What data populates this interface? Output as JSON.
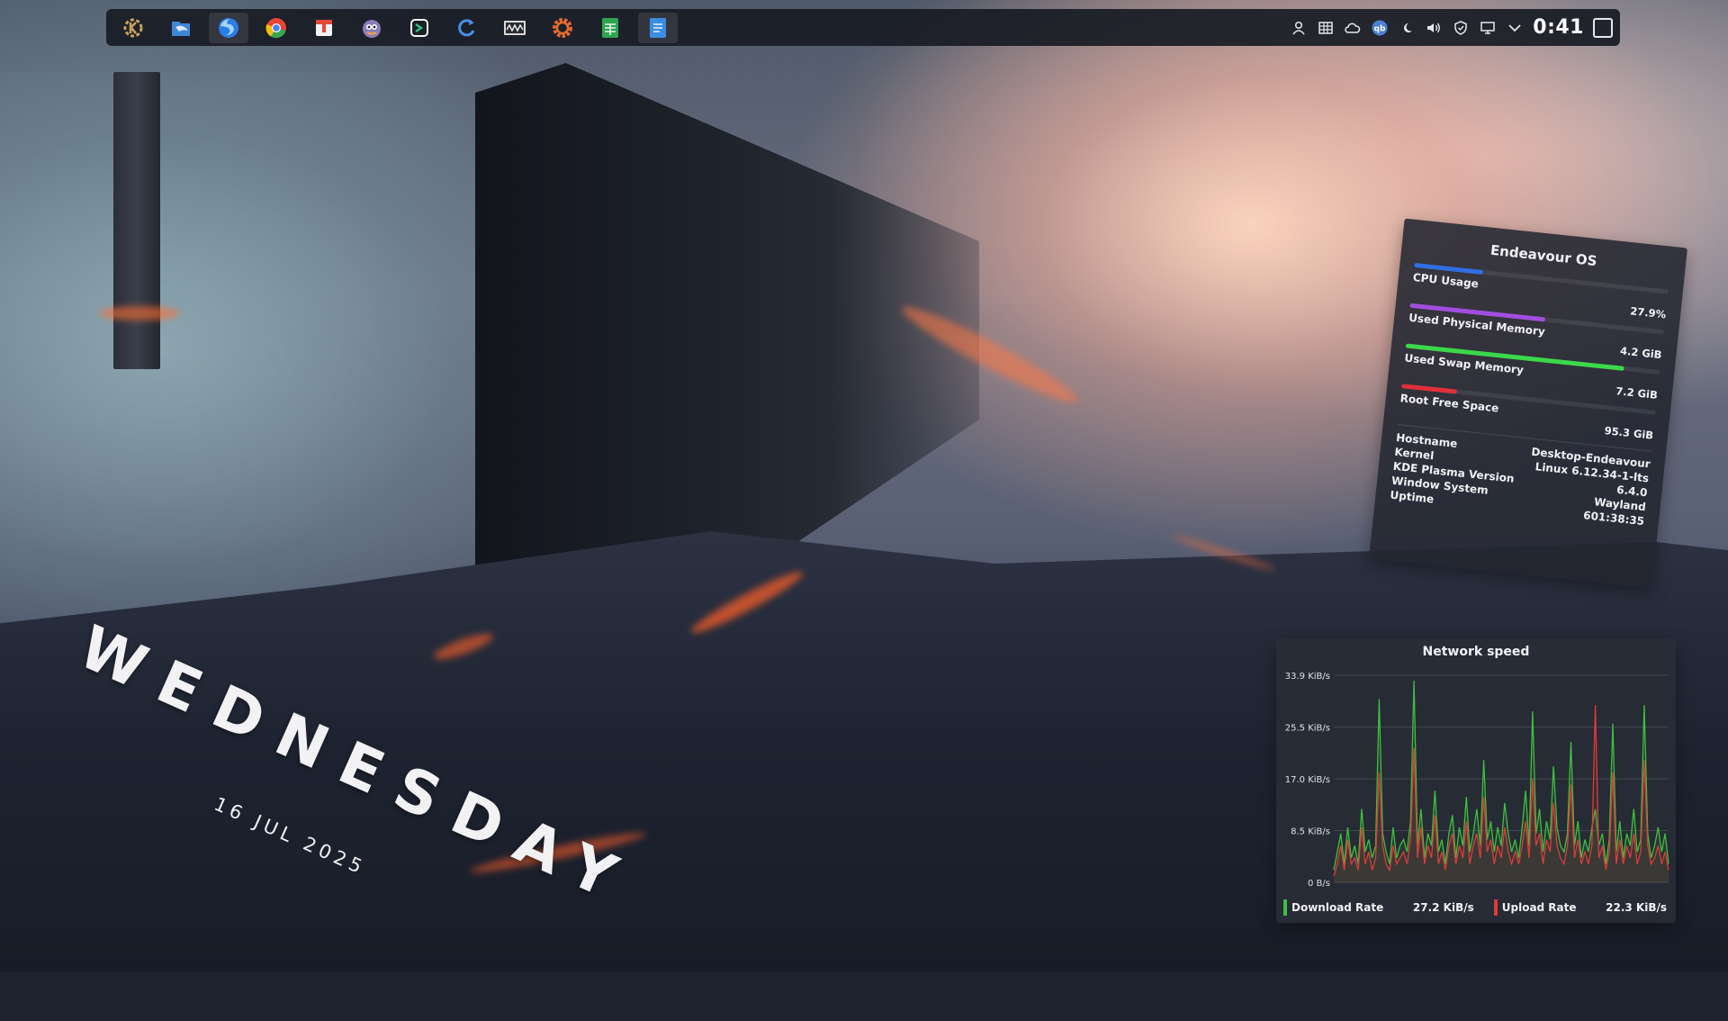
{
  "taskbar": {
    "launchers": [
      {
        "icon": "kde-icon",
        "color": "#c9a25a"
      },
      {
        "icon": "dolphin-icon",
        "color": "#3f86d6"
      },
      {
        "icon": "firefox-icon",
        "color": "#2b7de9"
      },
      {
        "icon": "chrome-icon",
        "color": "#ea4335"
      },
      {
        "icon": "archive-icon",
        "color": "#e24a3a"
      },
      {
        "icon": "gimp-icon",
        "color": "#8b7db8"
      },
      {
        "icon": "terminal-icon",
        "color": "#2bbf8a"
      },
      {
        "icon": "refresh-app-icon",
        "color": "#4a8fe7"
      },
      {
        "icon": "system-monitor-icon",
        "color": "#d8d8d8"
      },
      {
        "icon": "settings-gear-icon",
        "color": "#e56a2c"
      },
      {
        "icon": "spreadsheet-icon",
        "color": "#2ea44f"
      },
      {
        "icon": "document-icon",
        "color": "#3b8ce3"
      }
    ],
    "tray": [
      "user-icon",
      "grid-icon",
      "cloud-icon",
      "qbittorrent-icon",
      "night-mode-icon",
      "volume-icon",
      "shield-icon",
      "display-icon",
      "chevron-down-icon"
    ],
    "qbittorrent_label": "qb",
    "clock": "0:41"
  },
  "day_widget": {
    "day": "WEDNESDAY",
    "date": "16 JUL 2025"
  },
  "system_widget": {
    "title": "Endeavour OS",
    "metrics": [
      {
        "label": "CPU Usage",
        "value": "27.9%",
        "fill": 0.27,
        "color": "#2f6fe0"
      },
      {
        "label": "Used Physical Memory",
        "value": "4.2 GiB",
        "fill": 0.53,
        "color": "#a24de0"
      },
      {
        "label": "Used Swap Memory",
        "value": "7.2 GiB",
        "fill": 0.86,
        "color": "#3bd84a"
      },
      {
        "label": "Root Free Space",
        "value": "95.3 GiB",
        "fill": 0.22,
        "color": "#e0303a"
      }
    ],
    "info": [
      {
        "key": "Hostname",
        "value": "Desktop-Endeavour"
      },
      {
        "key": "Kernel",
        "value": "Linux 6.12.34-1-lts"
      },
      {
        "key": "KDE Plasma Version",
        "value": "6.4.0"
      },
      {
        "key": "Window System",
        "value": "Wayland"
      },
      {
        "key": "Uptime",
        "value": "601:38:35"
      }
    ]
  },
  "network_widget": {
    "title": "Network speed",
    "legend": {
      "download_label": "Download Rate",
      "download_value": "27.2 KiB/s",
      "download_color": "#3fbf3f",
      "upload_label": "Upload Rate",
      "upload_value": "22.3 KiB/s",
      "upload_color": "#e03a3a"
    }
  },
  "chart_data": {
    "type": "line",
    "title": "Network speed",
    "y_ticks": [
      "33.9 KiB/s",
      "25.5 KiB/s",
      "17.0 KiB/s",
      "8.5 KiB/s",
      "0 B/s"
    ],
    "ylim": [
      0,
      33.9
    ],
    "grid": true,
    "series": [
      {
        "name": "Download Rate",
        "color": "#3fbf3f",
        "values": [
          2,
          5,
          8,
          3,
          9,
          4,
          6,
          3,
          12,
          5,
          7,
          4,
          6,
          30,
          8,
          5,
          3,
          9,
          4,
          6,
          7,
          5,
          10,
          33,
          6,
          12,
          4,
          8,
          6,
          15,
          5,
          7,
          3,
          8,
          11,
          4,
          9,
          6,
          14,
          5,
          8,
          12,
          6,
          20,
          7,
          10,
          5,
          9,
          6,
          13,
          8,
          5,
          7,
          4,
          9,
          15,
          6,
          28,
          8,
          12,
          5,
          10,
          7,
          19,
          9,
          6,
          5,
          8,
          23,
          6,
          10,
          4,
          7,
          5,
          9,
          12,
          6,
          8,
          3,
          7,
          26,
          5,
          10,
          4,
          8,
          6,
          12,
          5,
          7,
          29,
          8,
          4,
          6,
          9,
          5,
          8,
          3
        ]
      },
      {
        "name": "Upload Rate",
        "color": "#e03a3a",
        "values": [
          1,
          3,
          6,
          2,
          7,
          3,
          4,
          2,
          9,
          3,
          5,
          2,
          4,
          18,
          6,
          3,
          2,
          6,
          3,
          4,
          5,
          3,
          7,
          22,
          4,
          9,
          3,
          6,
          4,
          11,
          3,
          5,
          2,
          6,
          8,
          3,
          6,
          4,
          10,
          3,
          6,
          8,
          4,
          14,
          5,
          7,
          3,
          6,
          4,
          9,
          5,
          3,
          5,
          3,
          6,
          10,
          4,
          17,
          6,
          8,
          3,
          7,
          5,
          13,
          6,
          4,
          3,
          6,
          16,
          4,
          7,
          3,
          5,
          3,
          6,
          29,
          4,
          6,
          2,
          5,
          18,
          3,
          7,
          3,
          6,
          4,
          8,
          3,
          5,
          20,
          6,
          3,
          4,
          6,
          3,
          5,
          2
        ]
      }
    ]
  }
}
